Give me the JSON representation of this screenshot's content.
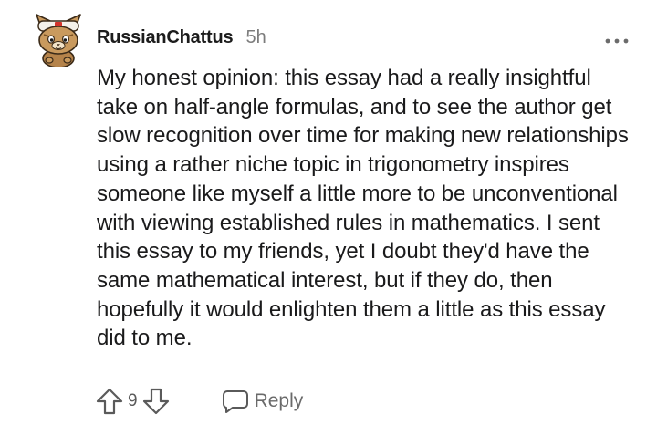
{
  "comment": {
    "username": "RussianChattus",
    "timestamp": "5h",
    "body": "My honest opinion: this essay had a really insightful take on half-angle formulas, and to see the author get slow recognition over time for making new relationships using a rather niche topic in trigonometry inspires someone like myself a little more to be unconventional with viewing established rules in mathematics. I sent this essay to my friends, yet I doubt they'd have the same mathematical interest, but if they do, then hopefully it would enlighten them a little as this essay did to me.",
    "vote_count": "9",
    "reply_label": "Reply"
  },
  "icons": {
    "avatar": "cartoon-avatar-icon",
    "more": "more-options-icon",
    "upvote": "upvote-arrow-icon",
    "downvote": "downvote-arrow-icon",
    "reply": "speech-bubble-icon"
  },
  "colors": {
    "username": "#1c1c1c",
    "text": "#1a1a1b",
    "muted": "#7c7c7c",
    "icon": "#5a5a5a"
  }
}
